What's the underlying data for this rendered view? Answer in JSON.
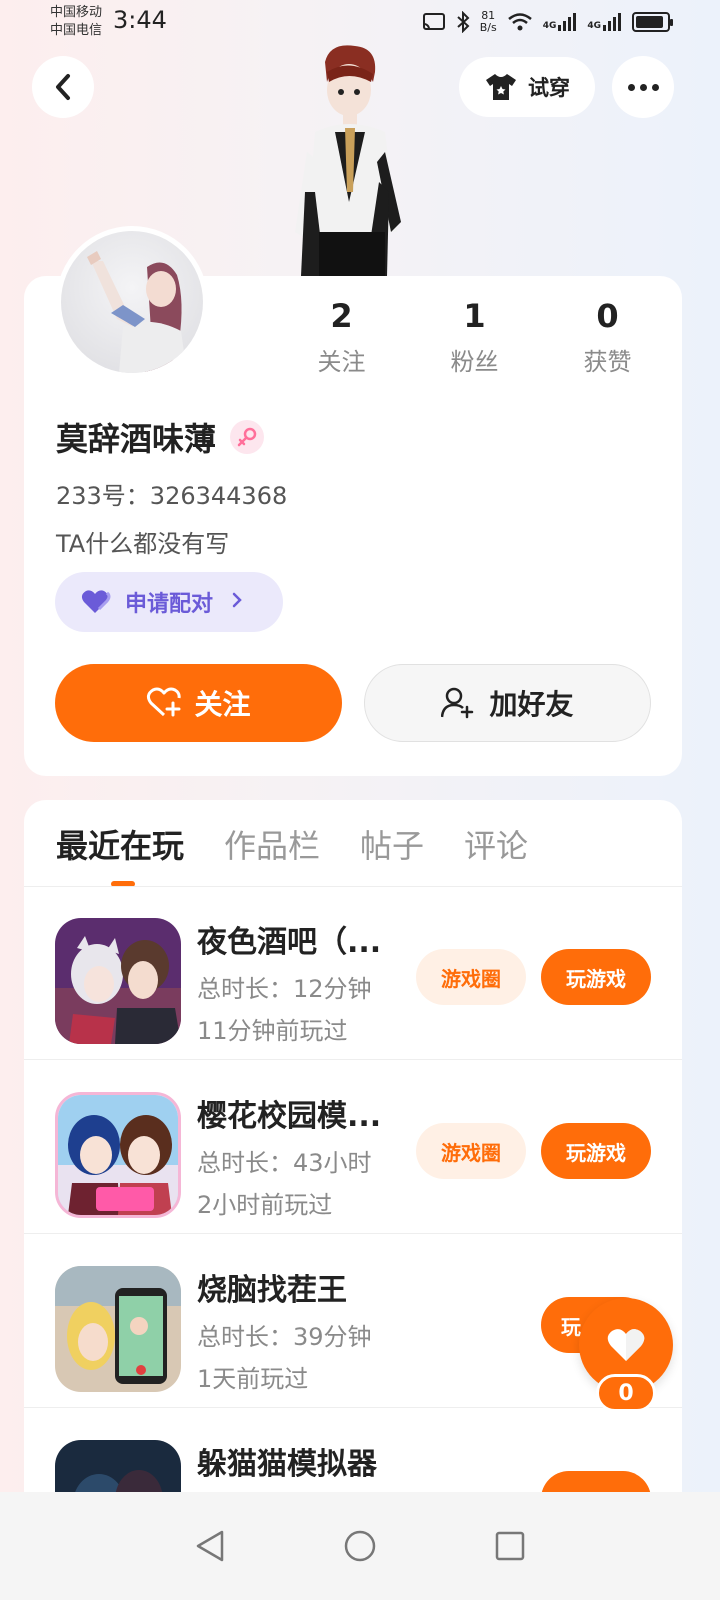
{
  "status_bar": {
    "carrier_1": "中国移动",
    "carrier_2": "中国电信",
    "time": "3:44",
    "net_speed_value": "81",
    "net_speed_unit": "B/s",
    "network_1": "4G",
    "network_2": "4G"
  },
  "header": {
    "try_on_label": "试穿"
  },
  "profile": {
    "stats": [
      {
        "value": "2",
        "label": "关注"
      },
      {
        "value": "1",
        "label": "粉丝"
      },
      {
        "value": "0",
        "label": "获赞"
      }
    ],
    "username": "莫辞酒味薄",
    "gender_icon": "female-icon",
    "id_text": "233号：326344368",
    "bio": "TA什么都没有写",
    "pair_label": "申请配对",
    "follow_label": "关注",
    "add_friend_label": "加好友"
  },
  "tabs": [
    {
      "label": "最近在玩",
      "active": true
    },
    {
      "label": "作品栏",
      "active": false
    },
    {
      "label": "帖子",
      "active": false
    },
    {
      "label": "评论",
      "active": false
    }
  ],
  "games": [
    {
      "title": "夜色酒吧（...",
      "duration": "总时长：12分钟",
      "last_played": "11分钟前玩过",
      "circle_label": "游戏圈",
      "play_label": "玩游戏"
    },
    {
      "title": "樱花校园模...",
      "duration": "总时长：43小时",
      "last_played": "2小时前玩过",
      "circle_label": "游戏圈",
      "play_label": "玩游戏"
    },
    {
      "title": "烧脑找茬王",
      "duration": "总时长：39分钟",
      "last_played": "1天前玩过",
      "play_label": "玩"
    },
    {
      "title": "躲猫猫模拟器"
    }
  ],
  "floating_like": {
    "count": "0"
  },
  "colors": {
    "accent": "#ff6d0a",
    "pair_bg": "#ebe9fb",
    "pair_text": "#6b5bd8"
  }
}
